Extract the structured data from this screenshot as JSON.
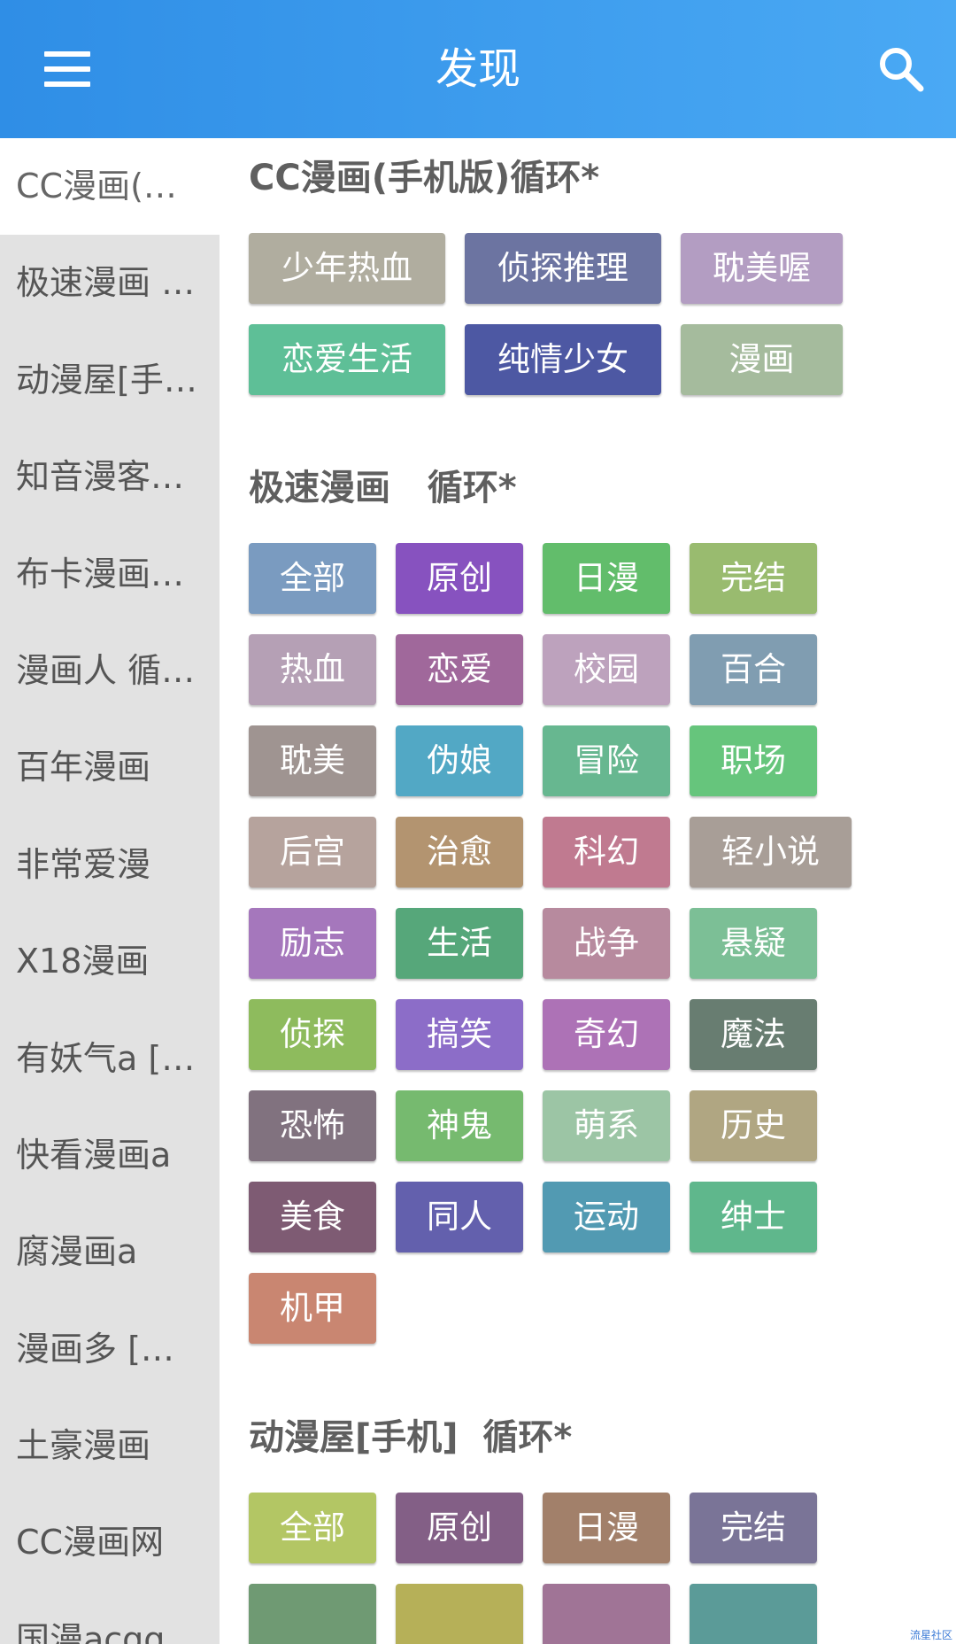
{
  "header": {
    "title": "发现"
  },
  "sidebar": {
    "items": [
      {
        "label": "CC漫画(手机版)循环*",
        "active": true
      },
      {
        "label": "极速漫画 循环*"
      },
      {
        "label": "动漫屋[手机] 循环*"
      },
      {
        "label": "知音漫客（循环*"
      },
      {
        "label": "布卡漫画（循环*"
      },
      {
        "label": "漫画人  循环*"
      },
      {
        "label": "百年漫画"
      },
      {
        "label": "非常爱漫"
      },
      {
        "label": "X18漫画"
      },
      {
        "label": "有妖气a [循环*"
      },
      {
        "label": "快看漫画a"
      },
      {
        "label": "腐漫画a"
      },
      {
        "label": "漫画多  [循环*"
      },
      {
        "label": "土豪漫画"
      },
      {
        "label": "CC漫画网"
      },
      {
        "label": "国漫acgq"
      }
    ]
  },
  "sections": [
    {
      "title": "CC漫画(手机版)循环*",
      "tags": [
        {
          "label": "少年热血",
          "color": "#b0ad9f"
        },
        {
          "label": "侦探推理",
          "color": "#6c74a1"
        },
        {
          "label": "耽美喔",
          "color": "#b39dc2"
        },
        {
          "label": "恋爱生活",
          "color": "#5ebf97"
        },
        {
          "label": "纯情少女",
          "color": "#4d58a3"
        },
        {
          "label": "漫画",
          "color": "#a5bb9d"
        }
      ]
    },
    {
      "title": "极速漫画   循环*",
      "tags": [
        {
          "label": "全部",
          "color": "#7a9bc0"
        },
        {
          "label": "原创",
          "color": "#8752bf"
        },
        {
          "label": "日漫",
          "color": "#62bd6b"
        },
        {
          "label": "完结",
          "color": "#99bb6f"
        },
        {
          "label": "热血",
          "color": "#b5a0b5"
        },
        {
          "label": "恋爱",
          "color": "#a0689b"
        },
        {
          "label": "校园",
          "color": "#bda2bd"
        },
        {
          "label": "百合",
          "color": "#809db1"
        },
        {
          "label": "耽美",
          "color": "#9f9491"
        },
        {
          "label": "伪娘",
          "color": "#52a8c5"
        },
        {
          "label": "冒险",
          "color": "#67b790"
        },
        {
          "label": "职场",
          "color": "#66c57c"
        },
        {
          "label": "后宫",
          "color": "#b6a39d"
        },
        {
          "label": "治愈",
          "color": "#b39470"
        },
        {
          "label": "科幻",
          "color": "#c07a90"
        },
        {
          "label": "轻小说",
          "color": "#a89e97"
        },
        {
          "label": "励志",
          "color": "#a577bc"
        },
        {
          "label": "生活",
          "color": "#56a77a"
        },
        {
          "label": "战争",
          "color": "#b78a9e"
        },
        {
          "label": "悬疑",
          "color": "#7cbf96"
        },
        {
          "label": "侦探",
          "color": "#8ebb5d"
        },
        {
          "label": "搞笑",
          "color": "#8c6dc8"
        },
        {
          "label": "奇幻",
          "color": "#ad72b6"
        },
        {
          "label": "魔法",
          "color": "#687d71"
        },
        {
          "label": "恐怖",
          "color": "#81727f"
        },
        {
          "label": "神鬼",
          "color": "#76ba6f"
        },
        {
          "label": "萌系",
          "color": "#9cc5a5"
        },
        {
          "label": "历史",
          "color": "#b0a682"
        },
        {
          "label": "美食",
          "color": "#7e5b73"
        },
        {
          "label": "同人",
          "color": "#6360ad"
        },
        {
          "label": "运动",
          "color": "#529ab2"
        },
        {
          "label": "绅士",
          "color": "#5fb78c"
        },
        {
          "label": "机甲",
          "color": "#c98671"
        }
      ]
    },
    {
      "title": "动漫屋[手机]  循环*",
      "tags": [
        {
          "label": "全部",
          "color": "#b3c664"
        },
        {
          "label": "原创",
          "color": "#835f86"
        },
        {
          "label": "日漫",
          "color": "#a2806a"
        },
        {
          "label": "完结",
          "color": "#7a7497"
        },
        {
          "label": "",
          "color": "#6f9a73"
        },
        {
          "label": "",
          "color": "#b6b058"
        },
        {
          "label": "",
          "color": "#a07496"
        },
        {
          "label": "",
          "color": "#5b9b98"
        }
      ]
    }
  ],
  "watermark": "流星社区"
}
